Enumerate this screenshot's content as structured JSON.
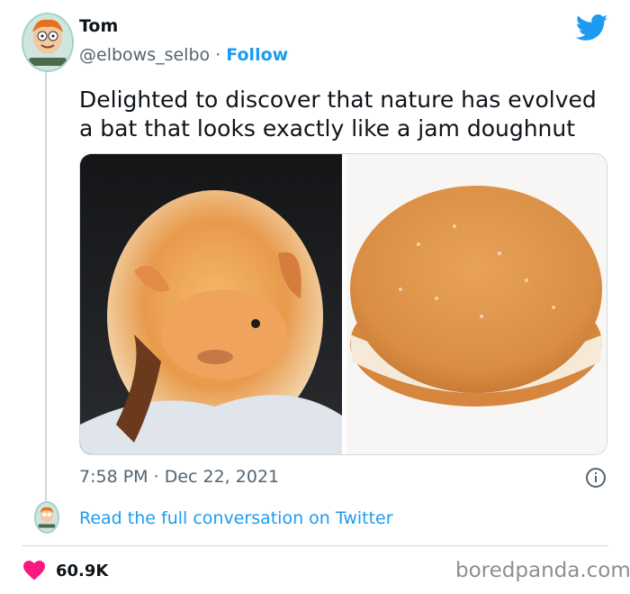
{
  "tweet": {
    "author_name": "Tom",
    "handle": "@elbows_selbo",
    "separator": "·",
    "follow_label": "Follow",
    "text_line1": "Delighted to discover that nature has evolved",
    "text_line2": "a bat that looks exactly like a jam doughnut",
    "time": "7:58 PM",
    "date": "Dec 22, 2021",
    "read_link": "Read the full conversation on Twitter",
    "likes": "60.9K"
  },
  "icons": {
    "logo": "twitter-bird-icon",
    "info": "info-icon",
    "heart": "heart-icon"
  },
  "colors": {
    "accent": "#1d9bf0",
    "heart": "#f91880",
    "muted": "#536471",
    "text": "#0f1419",
    "border": "#cfd9de"
  },
  "watermark": "boredpanda.com"
}
